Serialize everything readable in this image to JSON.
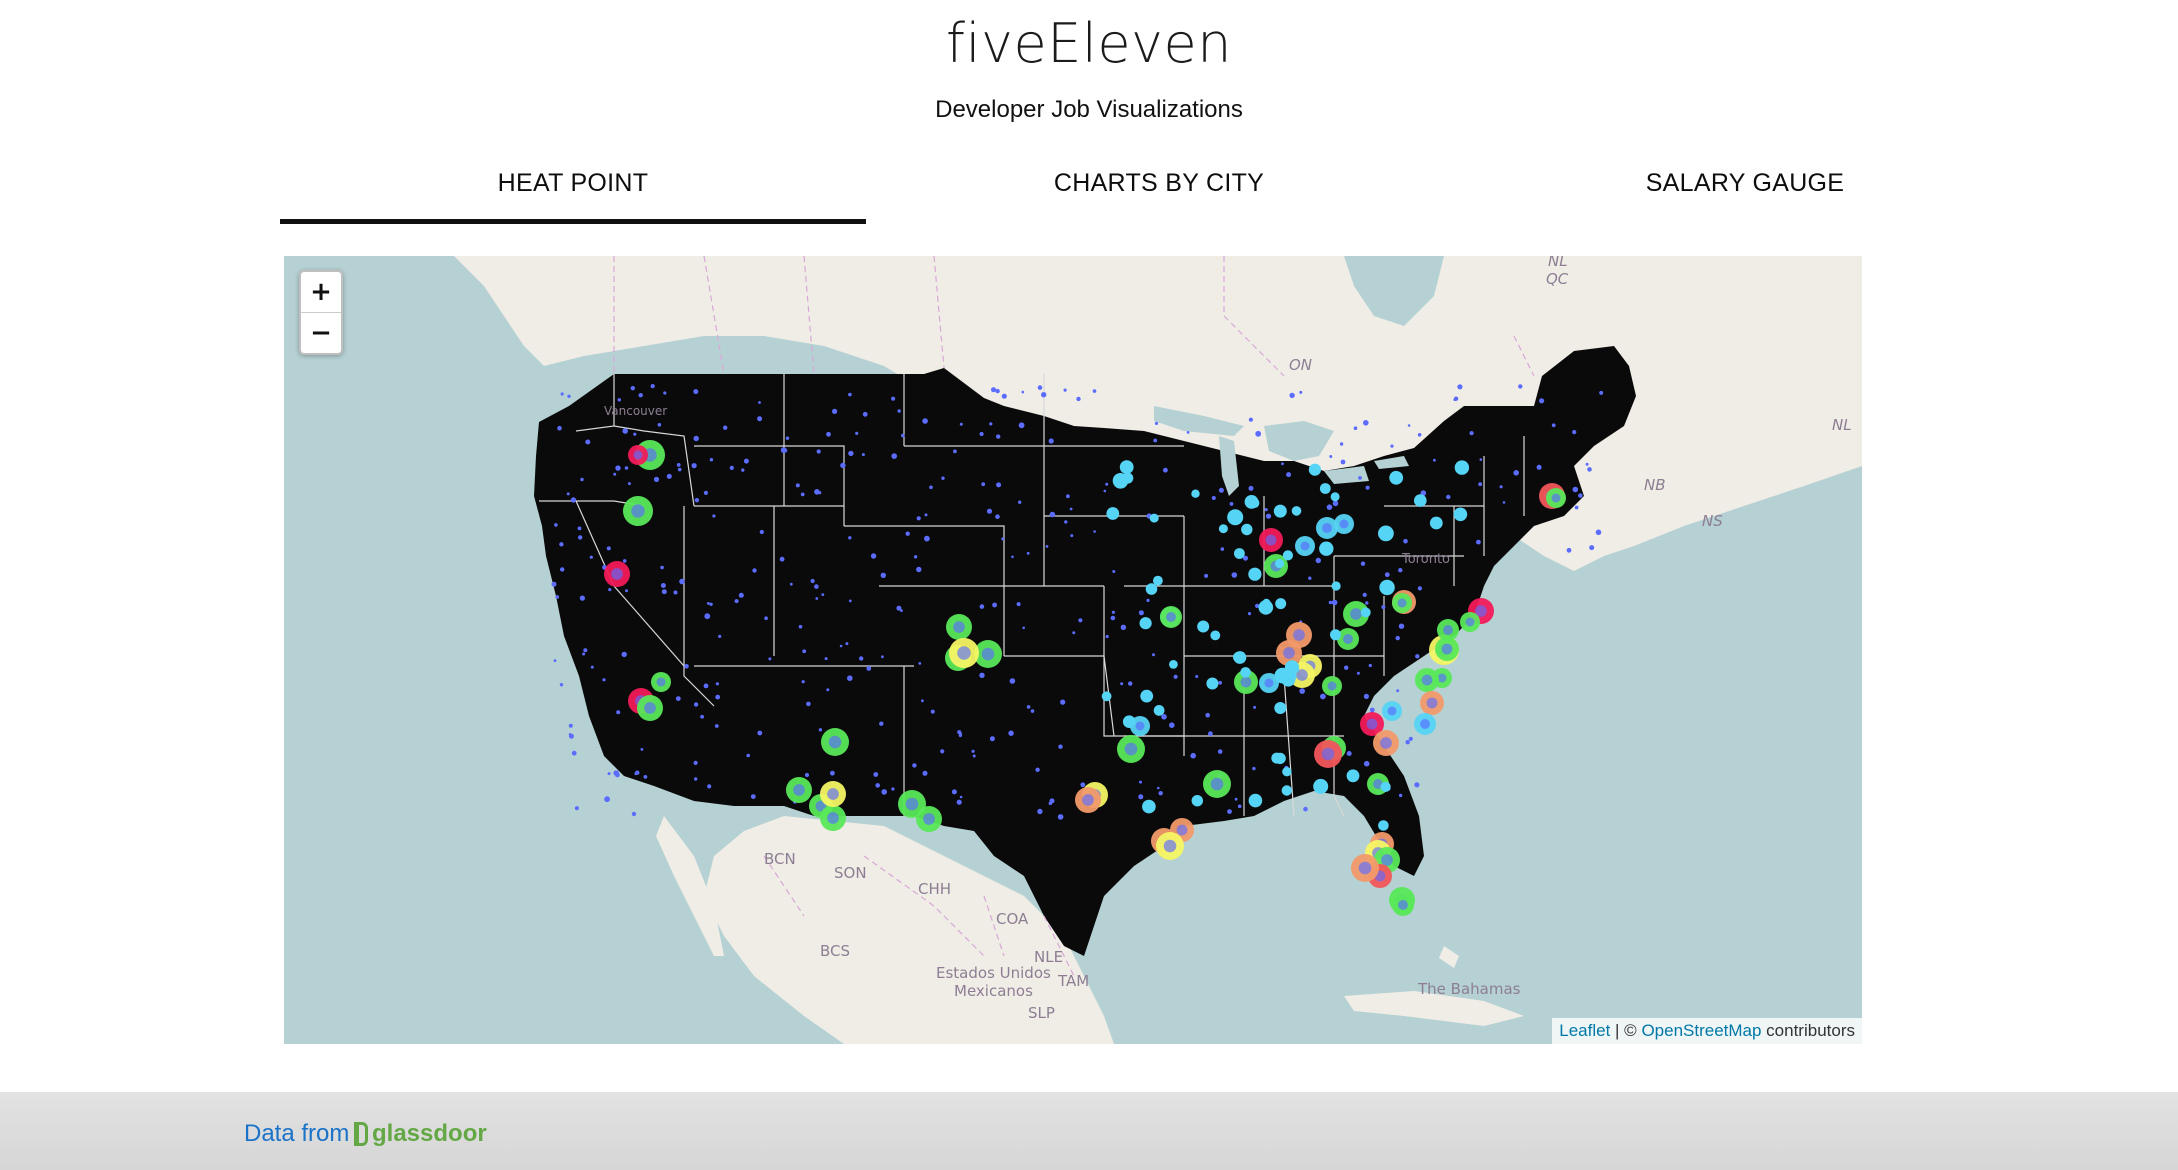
{
  "app": {
    "title": "fiveEleven",
    "subtitle": "Developer Job Visualizations"
  },
  "tabs": [
    {
      "label": "HEAT POINT",
      "active": true
    },
    {
      "label": "CHARTS BY CITY",
      "active": false
    },
    {
      "label": "SALARY GAUGE",
      "active": false
    }
  ],
  "map": {
    "zoom_in_label": "+",
    "zoom_out_label": "−",
    "attribution": {
      "leaflet": "Leaflet",
      "separator": " | © ",
      "osm": "OpenStreetMap",
      "suffix": " contributors"
    },
    "labels": {
      "qc": "QC",
      "nl_top": "NL",
      "on": "ON",
      "vancouver": "Vancouver",
      "nl": "NL",
      "nb": "NB",
      "ns": "NS",
      "toronto": "Toronto",
      "bcn": "BCN",
      "son": "SON",
      "chh": "CHH",
      "coa": "COA",
      "bcs": "BCS",
      "nle": "NLE",
      "mexico1": "Estados Unidos",
      "mexico2": "Mexicanos",
      "tam": "TAM",
      "slp": "SLP",
      "bahamas": "The Bahamas"
    },
    "colors": {
      "water": "#b6d1d3",
      "land": "#f0ede6",
      "usa": "#0a0a0a",
      "dot": "#5b6cff",
      "cyan": "#56d4f5",
      "green": "#58e858",
      "yellow": "#f5f564",
      "orange": "#f29a6a",
      "red": "#f2565a",
      "pink": "#f21a5a"
    }
  },
  "footer": {
    "prefix": "Data from",
    "brand": "glassdoor"
  }
}
